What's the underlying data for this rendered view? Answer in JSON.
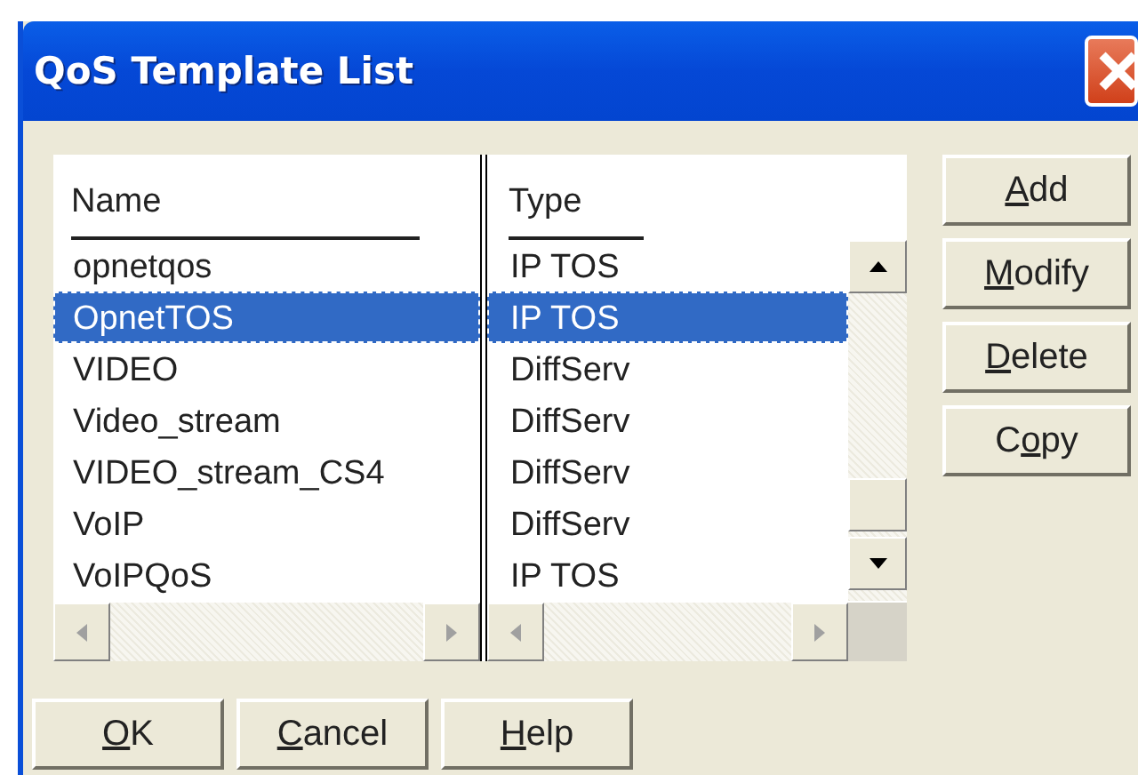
{
  "window": {
    "title": "QoS Template List"
  },
  "table": {
    "columns": [
      "Name",
      "Type"
    ],
    "rows": [
      {
        "name": "opnetqos",
        "type": "IP TOS",
        "selected": false
      },
      {
        "name": "OpnetTOS",
        "type": "IP TOS",
        "selected": true
      },
      {
        "name": "VIDEO",
        "type": "DiffServ",
        "selected": false
      },
      {
        "name": "Video_stream",
        "type": "DiffServ",
        "selected": false
      },
      {
        "name": "VIDEO_stream_CS4",
        "type": "DiffServ",
        "selected": false
      },
      {
        "name": "VoIP",
        "type": "DiffServ",
        "selected": false
      },
      {
        "name": "VoIPQoS",
        "type": "IP TOS",
        "selected": false
      }
    ]
  },
  "side_buttons": [
    {
      "label_parts": [
        {
          "text": "A",
          "underlined": true
        },
        {
          "text": "dd",
          "underlined": false
        }
      ]
    },
    {
      "label_parts": [
        {
          "text": "M",
          "underlined": true
        },
        {
          "text": "odify",
          "underlined": false
        }
      ]
    },
    {
      "label_parts": [
        {
          "text": "D",
          "underlined": true
        },
        {
          "text": "elete",
          "underlined": false
        }
      ]
    },
    {
      "label_parts": [
        {
          "text": "C",
          "underlined": false
        },
        {
          "text": "o",
          "underlined": true
        },
        {
          "text": "py",
          "underlined": false
        }
      ]
    }
  ],
  "bottom_buttons": [
    {
      "label_parts": [
        {
          "text": "O",
          "underlined": true
        },
        {
          "text": "K",
          "underlined": false
        }
      ]
    },
    {
      "label_parts": [
        {
          "text": "C",
          "underlined": true
        },
        {
          "text": "ancel",
          "underlined": false
        }
      ]
    },
    {
      "label_parts": [
        {
          "text": "H",
          "underlined": true
        },
        {
          "text": "elp",
          "underlined": false
        }
      ]
    }
  ]
}
